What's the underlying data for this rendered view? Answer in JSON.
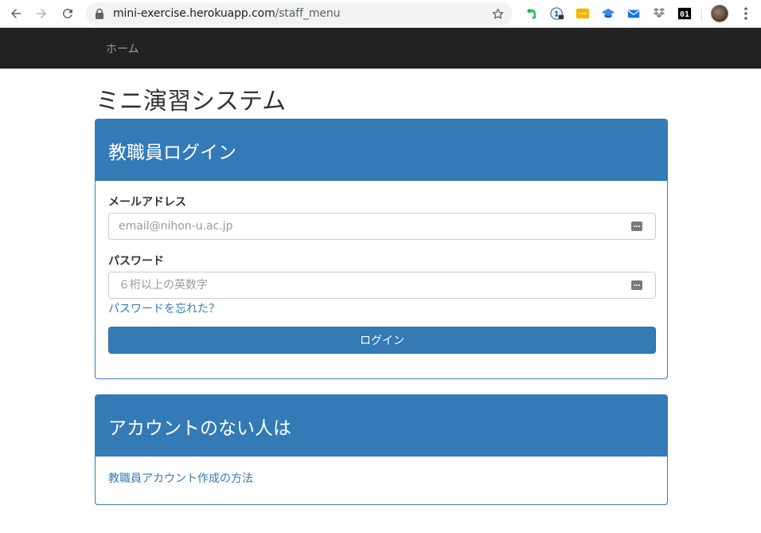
{
  "browser": {
    "url_host": "mini-exercise.herokuapp.com",
    "url_path": "/staff_menu",
    "extensions": [
      "evernote-icon",
      "password-manager-icon",
      "notes-extension-icon",
      "graduation-cap-icon",
      "mail-icon",
      "dropbox-icon",
      "counter-extension-icon"
    ],
    "counter_badge": "01"
  },
  "navbar": {
    "home_label": "ホーム"
  },
  "page": {
    "title": "ミニ演習システム"
  },
  "login_panel": {
    "heading": "教職員ログイン",
    "email_label": "メールアドレス",
    "email_placeholder": "email@nihon-u.ac.jp",
    "password_label": "パスワード",
    "password_placeholder": "６桁以上の英数字",
    "forgot_link": "パスワードを忘れた？",
    "login_button": "ログイン"
  },
  "account_panel": {
    "heading": "アカウントのない人は",
    "create_link": "教職員アカウント作成の方法"
  },
  "colors": {
    "primary": "#337ab7",
    "navbar_bg": "#222222",
    "navbar_text": "#9d9d9d"
  }
}
